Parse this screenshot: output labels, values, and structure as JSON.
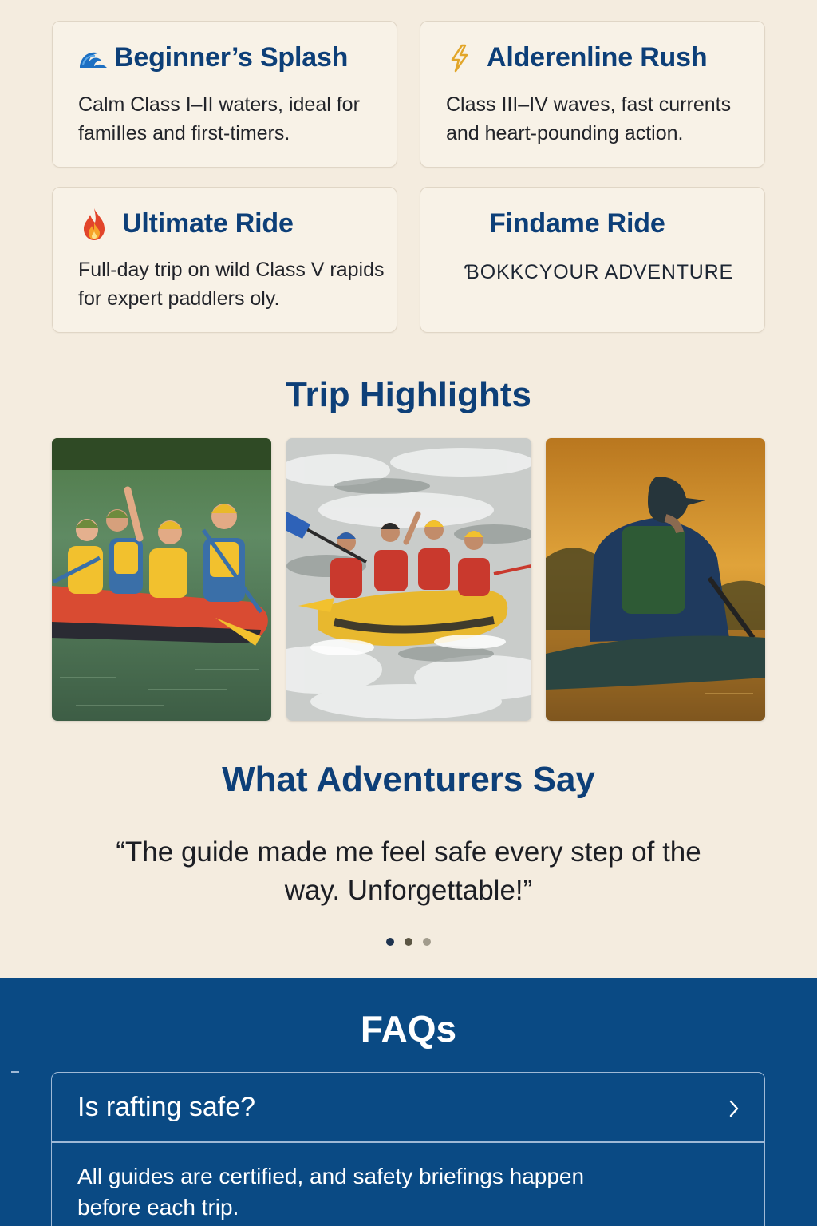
{
  "trips": [
    {
      "icon": "wave-icon",
      "title": "Beginner’s Splash",
      "description": "Calm Class I–II waters, ideal for famiIles and first-timers."
    },
    {
      "icon": "lightning-icon",
      "title": "Alderenline Rush",
      "description": "Class III–IV waves, fast currents and heart-pounding action."
    },
    {
      "icon": "fire-icon",
      "title": "Ultimate Ride",
      "description": "Full-day trip on wild Class V rapids for expert paddlers oly."
    },
    {
      "title": "Findame Ride",
      "cta": "ƁOKKCYOUR ADVENTURE"
    }
  ],
  "highlights": {
    "title": "Trip Highlights",
    "photos": [
      {
        "name": "group-rafting-photo"
      },
      {
        "name": "whitewater-rapids-photo"
      },
      {
        "name": "sunset-kayaker-photo"
      }
    ]
  },
  "testimonials": {
    "title": "What Adventurers Say",
    "quote": "“The guide made me feel safe every step of the way. Unforgettable!”",
    "carousel": {
      "count": 3,
      "active_index": 0
    }
  },
  "faqs": {
    "title": "FAQs",
    "items": [
      {
        "question": "Is rafting safe?",
        "answer": "All guides are certified, and safety briefings happen before each trip."
      }
    ]
  },
  "colors": {
    "background": "#f4ecdf",
    "heading_blue": "#0d3f78",
    "faq_band": "#0a4a84"
  }
}
